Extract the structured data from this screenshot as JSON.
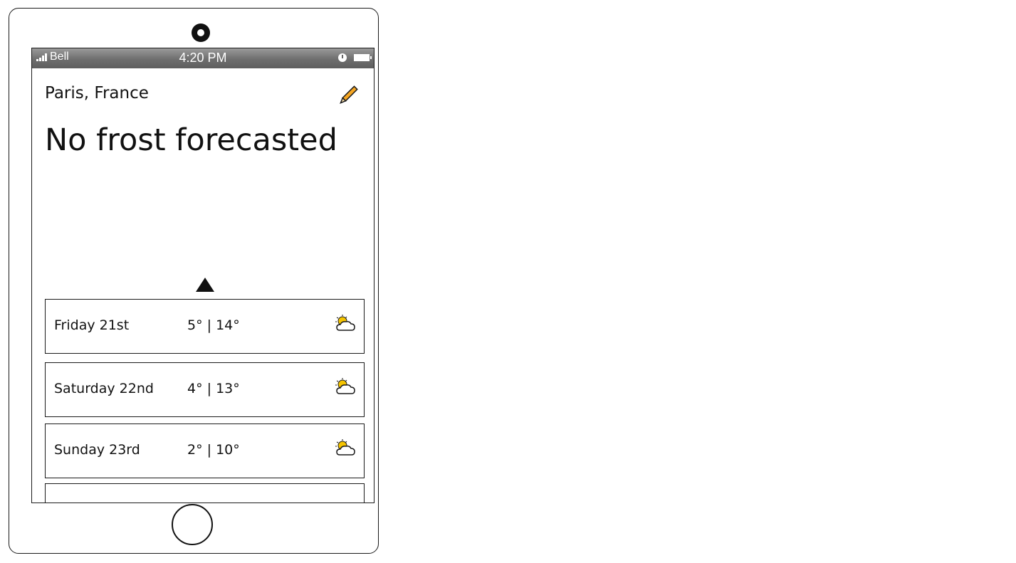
{
  "status_bar": {
    "carrier": "Bell",
    "time": "4:20 PM",
    "icons": [
      "signal-icon",
      "clock-icon",
      "battery-icon"
    ]
  },
  "header": {
    "location": "Paris, France",
    "edit_icon": "pencil-icon"
  },
  "main": {
    "headline": "No frost forecasted",
    "expand_icon": "triangle-up-icon"
  },
  "forecast": [
    {
      "day": "Friday 21st",
      "temps": "5° | 14°",
      "icon": "partly-cloudy-icon"
    },
    {
      "day": "Saturday 22nd",
      "temps": "4° | 13°",
      "icon": "partly-cloudy-icon"
    },
    {
      "day": "Sunday 23rd",
      "temps": "2° | 10°",
      "icon": "partly-cloudy-icon"
    },
    {
      "day": "",
      "temps": "",
      "icon": ""
    }
  ],
  "colors": {
    "status_bar": "#6e6e6e",
    "pencil": "#f5a623",
    "sun": "#f5c400",
    "outline": "#1a1a1a"
  }
}
